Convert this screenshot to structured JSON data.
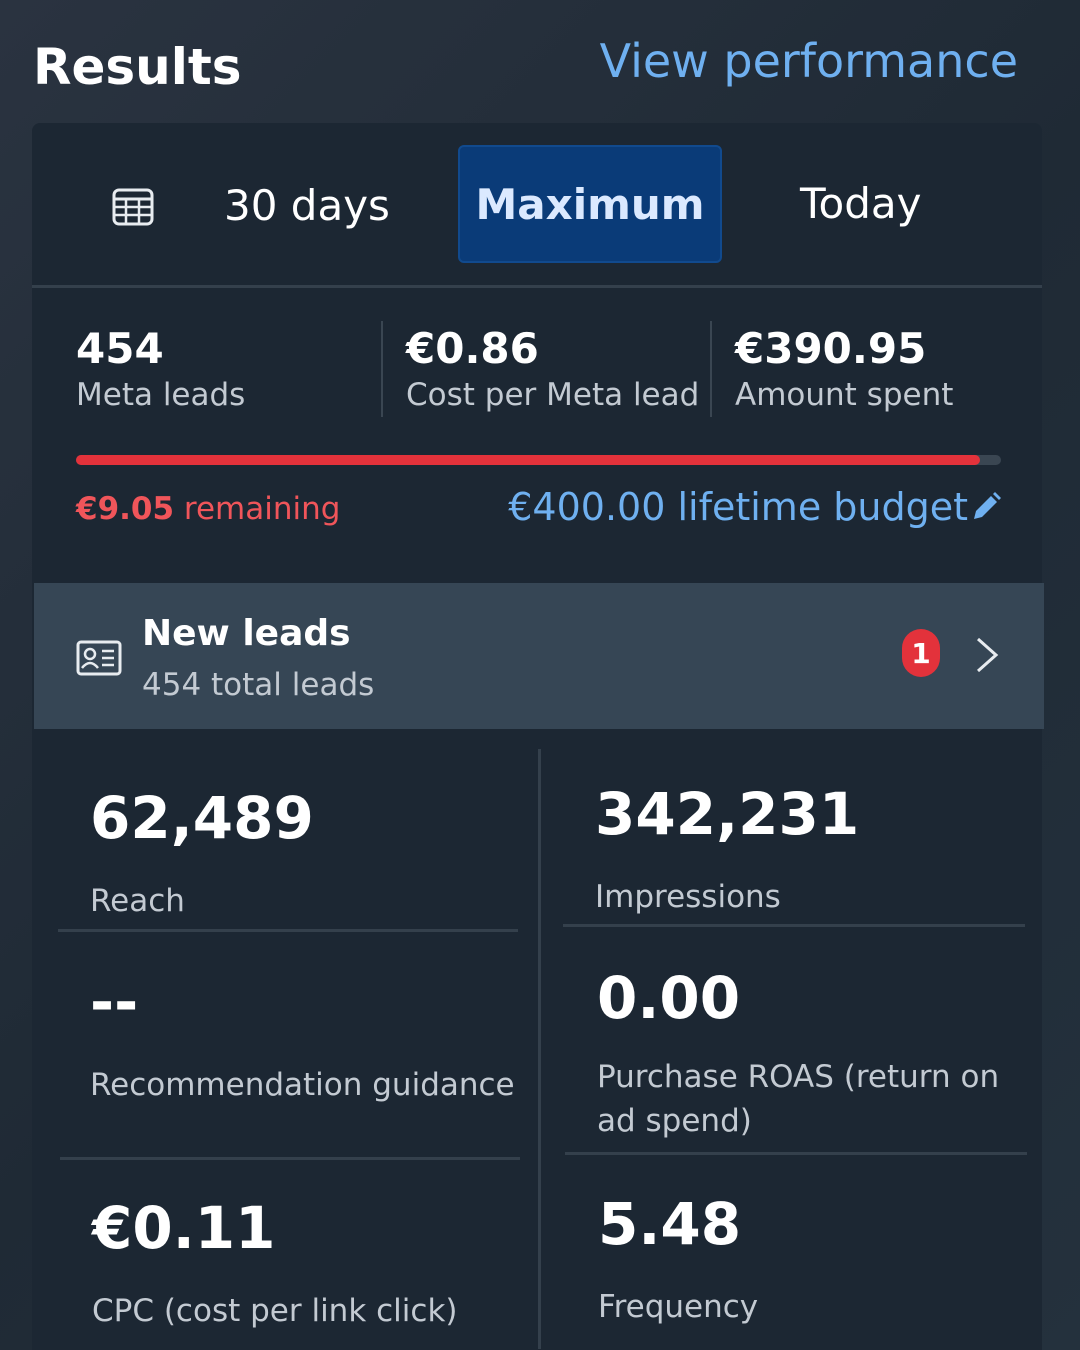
{
  "header": {
    "title": "Results",
    "view_performance": "View performance"
  },
  "tabs": {
    "items": [
      "30 days",
      "Maximum",
      "Today"
    ],
    "selected": "Maximum"
  },
  "metrics": [
    {
      "value": "454",
      "label": "Meta leads"
    },
    {
      "value": "€0.86",
      "label": "Cost per Meta lead"
    },
    {
      "value": "€390.95",
      "label": "Amount spent"
    }
  ],
  "budget": {
    "remaining_amount": "€9.05",
    "remaining_text": "remaining",
    "lifetime": "€400.00 lifetime budget",
    "spent_fraction": 0.977,
    "fill_color": "#e3323b"
  },
  "new_leads": {
    "title": "New leads",
    "subtitle": "454 total leads",
    "badge": "1"
  },
  "stats": [
    {
      "value": "62,489",
      "label": "Reach"
    },
    {
      "value": "342,231",
      "label": "Impressions"
    },
    {
      "value": "--",
      "label": "Recommendation guidance"
    },
    {
      "value": "0.00",
      "label": "Purchase ROAS (return on ad spend)"
    },
    {
      "value": "€0.11",
      "label": "CPC (cost per link click)"
    },
    {
      "value": "5.48",
      "label": "Frequency"
    }
  ],
  "icons": {
    "calendar": "calendar-icon",
    "pencil": "pencil-icon",
    "leads": "contact-card-icon",
    "chevron": "chevron-right-icon"
  },
  "colors": {
    "accent": "#6fb0f0",
    "selected_tab": "#0a3b78",
    "alert": "#e3323b"
  }
}
